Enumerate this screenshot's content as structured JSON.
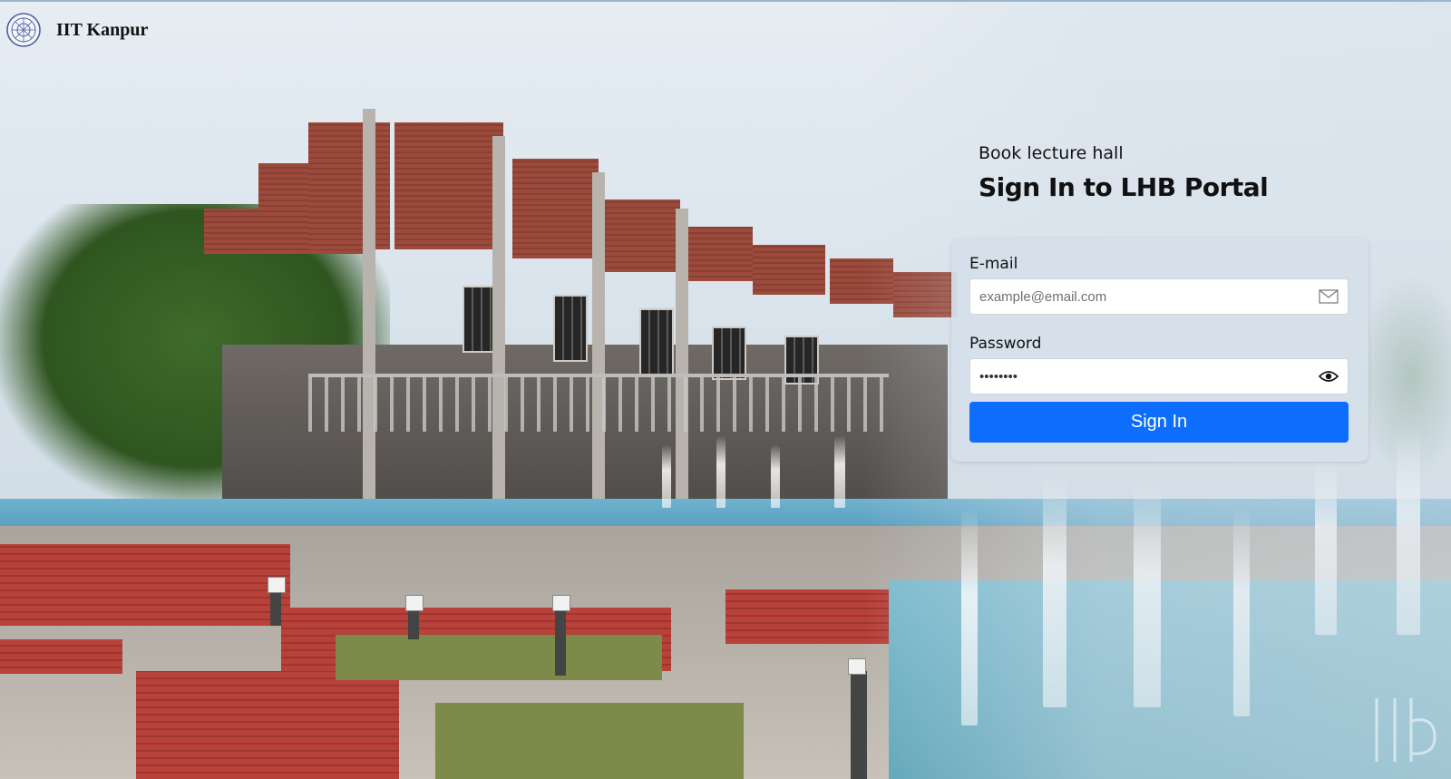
{
  "header": {
    "logo_icon": "iitk-emblem-icon",
    "brand": "IIT Kanpur"
  },
  "login": {
    "subtitle": "Book lecture hall",
    "title": "Sign In to LHB Portal",
    "email": {
      "label": "E-mail",
      "placeholder": "example@email.com",
      "value": "",
      "icon": "mail-icon"
    },
    "password": {
      "label": "Password",
      "value": "••••••••",
      "icon": "eye-icon"
    },
    "submit_label": "Sign In"
  },
  "colors": {
    "primary_button": "#0d6efd",
    "card_background": "#d6e0e9"
  }
}
